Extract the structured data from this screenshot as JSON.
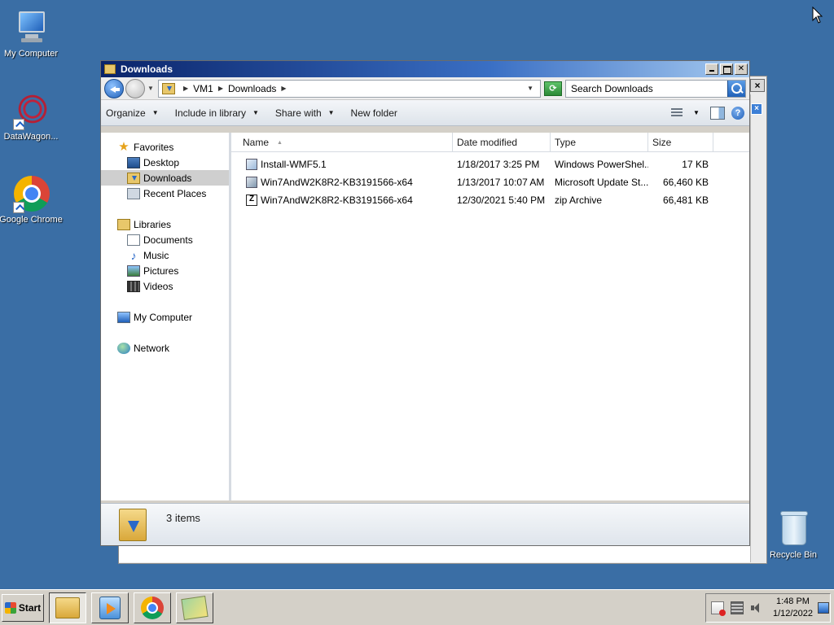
{
  "desktop": {
    "icons": [
      {
        "label": "My Computer"
      },
      {
        "label": "DataWagon..."
      },
      {
        "label": "Google Chrome"
      },
      {
        "label": "Recycle Bin"
      }
    ]
  },
  "window": {
    "title": "Downloads",
    "address": {
      "segments": [
        "VM1",
        "Downloads"
      ]
    },
    "search": {
      "placeholder": "Search Downloads"
    },
    "toolbar": {
      "organize": "Organize",
      "include_in_library": "Include in library",
      "share_with": "Share with",
      "new_folder": "New folder"
    },
    "nav": {
      "favorites": "Favorites",
      "desktop": "Desktop",
      "downloads": "Downloads",
      "recent_places": "Recent Places",
      "libraries": "Libraries",
      "documents": "Documents",
      "music": "Music",
      "pictures": "Pictures",
      "videos": "Videos",
      "my_computer": "My Computer",
      "network": "Network"
    },
    "columns": {
      "name": "Name",
      "date_modified": "Date modified",
      "type": "Type",
      "size": "Size"
    },
    "files": [
      {
        "name": "Install-WMF5.1",
        "date": "1/18/2017 3:25 PM",
        "type": "Windows PowerShel...",
        "size": "17 KB",
        "icon": "powershell-script-icon"
      },
      {
        "name": "Win7AndW2K8R2-KB3191566-x64",
        "date": "1/13/2017 10:07 AM",
        "type": "Microsoft Update St...",
        "size": "66,460 KB",
        "icon": "msu-package-icon"
      },
      {
        "name": "Win7AndW2K8R2-KB3191566-x64",
        "date": "12/30/2021 5:40 PM",
        "type": "zip Archive",
        "size": "66,481 KB",
        "icon": "zip-archive-icon"
      }
    ],
    "details": {
      "count": "3 items"
    }
  },
  "taskbar": {
    "start_label": "Start",
    "clock_time": "1:48 PM",
    "clock_date": "1/12/2022"
  }
}
